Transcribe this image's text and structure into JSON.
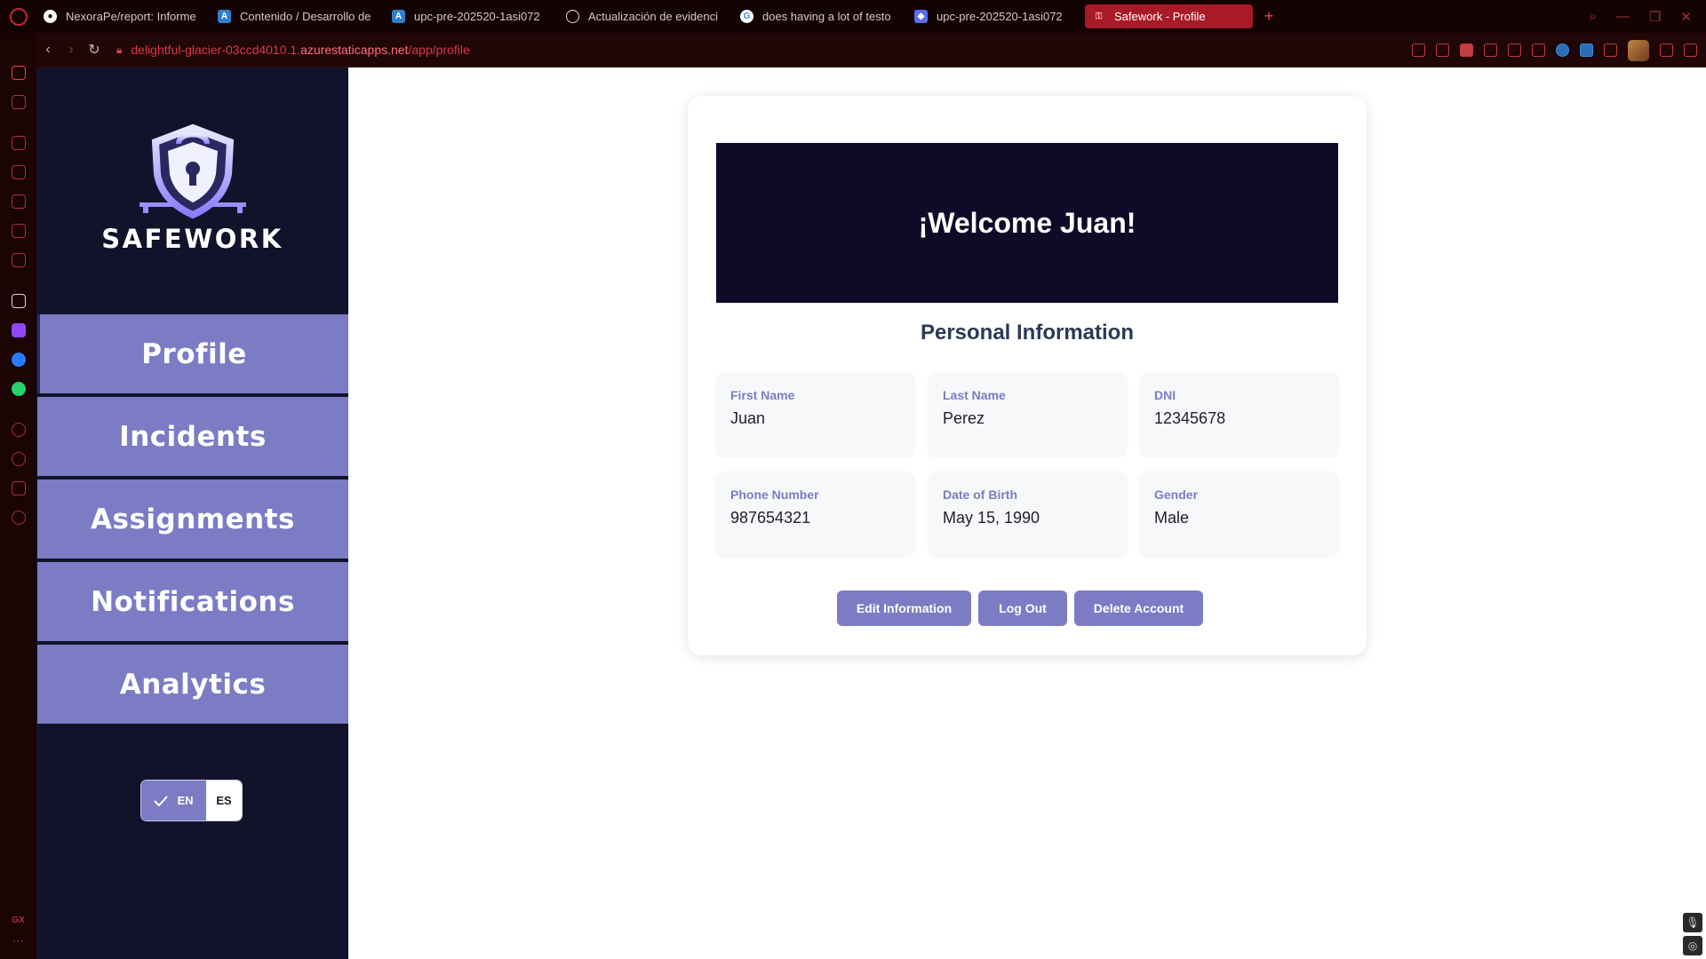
{
  "browser": {
    "tabs": [
      {
        "label": "NexoraPe/report: Informe",
        "icon": "github-icon",
        "color": "#ffffff"
      },
      {
        "label": "Contenido / Desarrollo de",
        "icon": "azure-devops-icon",
        "color": "#2f7fd0"
      },
      {
        "label": "upc-pre-202520-1asi072",
        "icon": "azure-devops-icon",
        "color": "#2f7fd0"
      },
      {
        "label": "Actualización de evidenci",
        "icon": "chatgpt-icon",
        "color": "#dddddd"
      },
      {
        "label": "does having a lot of testo",
        "icon": "google-icon",
        "color": "#ffffff"
      },
      {
        "label": "upc-pre-202520-1asi072",
        "icon": "app-icon",
        "color": "#5a6cf0"
      },
      {
        "label": "Safework - Profile",
        "icon": "safework-icon",
        "color": "#ff6f7a"
      }
    ],
    "url_prefix": "delightful-glacier-03ccd4010.1.",
    "url_domain": "azurestaticapps.net",
    "url_path": "/app/profile"
  },
  "sidebar": {
    "brand": "SAFEWORK",
    "items": [
      {
        "label": "Profile"
      },
      {
        "label": "Incidents"
      },
      {
        "label": "Assignments"
      },
      {
        "label": "Notifications"
      },
      {
        "label": "Analytics"
      }
    ],
    "lang": {
      "en": "EN",
      "es": "ES",
      "selected": "EN"
    }
  },
  "profile": {
    "welcome": "¡Welcome Juan!",
    "section_title": "Personal Information",
    "fields": [
      {
        "label": "First Name",
        "value": "Juan"
      },
      {
        "label": "Last Name",
        "value": "Perez"
      },
      {
        "label": "DNI",
        "value": "12345678"
      },
      {
        "label": "Phone Number",
        "value": "987654321"
      },
      {
        "label": "Date of Birth",
        "value": "May 15, 1990"
      },
      {
        "label": "Gender",
        "value": "Male"
      }
    ],
    "buttons": {
      "edit": "Edit Information",
      "logout": "Log Out",
      "delete": "Delete Account"
    }
  },
  "colors": {
    "accent": "#7b7cc4",
    "sidebar_bg": "#12132a",
    "banner_bg": "#0f0a28",
    "browser_accent": "#a81a26"
  }
}
